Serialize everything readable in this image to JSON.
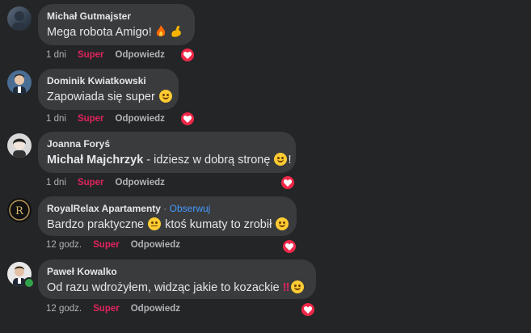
{
  "comments": [
    {
      "author": "Michał Gutmajster",
      "text": "Mega robota Amigo!",
      "time": "1 dni",
      "super_label": "Super",
      "reply_label": "Odpowiedz"
    },
    {
      "author": "Dominik Kwiatkowski",
      "text": "Zapowiada się super",
      "time": "1 dni",
      "super_label": "Super",
      "reply_label": "Odpowiedz"
    },
    {
      "author": "Joanna Foryś",
      "mention": "Michał Majchrzyk",
      "text": " - idziesz w dobrą stronę",
      "text_suffix": "!",
      "time": "1 dni",
      "super_label": "Super",
      "reply_label": "Odpowiedz"
    },
    {
      "author": "RoyalRelax Apartamenty",
      "separator": "·",
      "follow_label": "Obserwuj",
      "text": "Bardzo praktyczne",
      "text_middle": " ktoś kumaty to zrobił",
      "time": "12 godz.",
      "super_label": "Super",
      "reply_label": "Odpowiedz"
    },
    {
      "author": "Paweł Kowalko",
      "text": "Od razu wdrożyłem, widząc jakie to kozackie",
      "text_suffix": "‼",
      "time": "12 godz.",
      "super_label": "Super",
      "reply_label": "Odpowiedz"
    }
  ],
  "colors": {
    "background": "#242526",
    "bubble": "#3a3b3c",
    "super": "#e0245e",
    "heart": "#f02849",
    "follow": "#4599ff"
  }
}
